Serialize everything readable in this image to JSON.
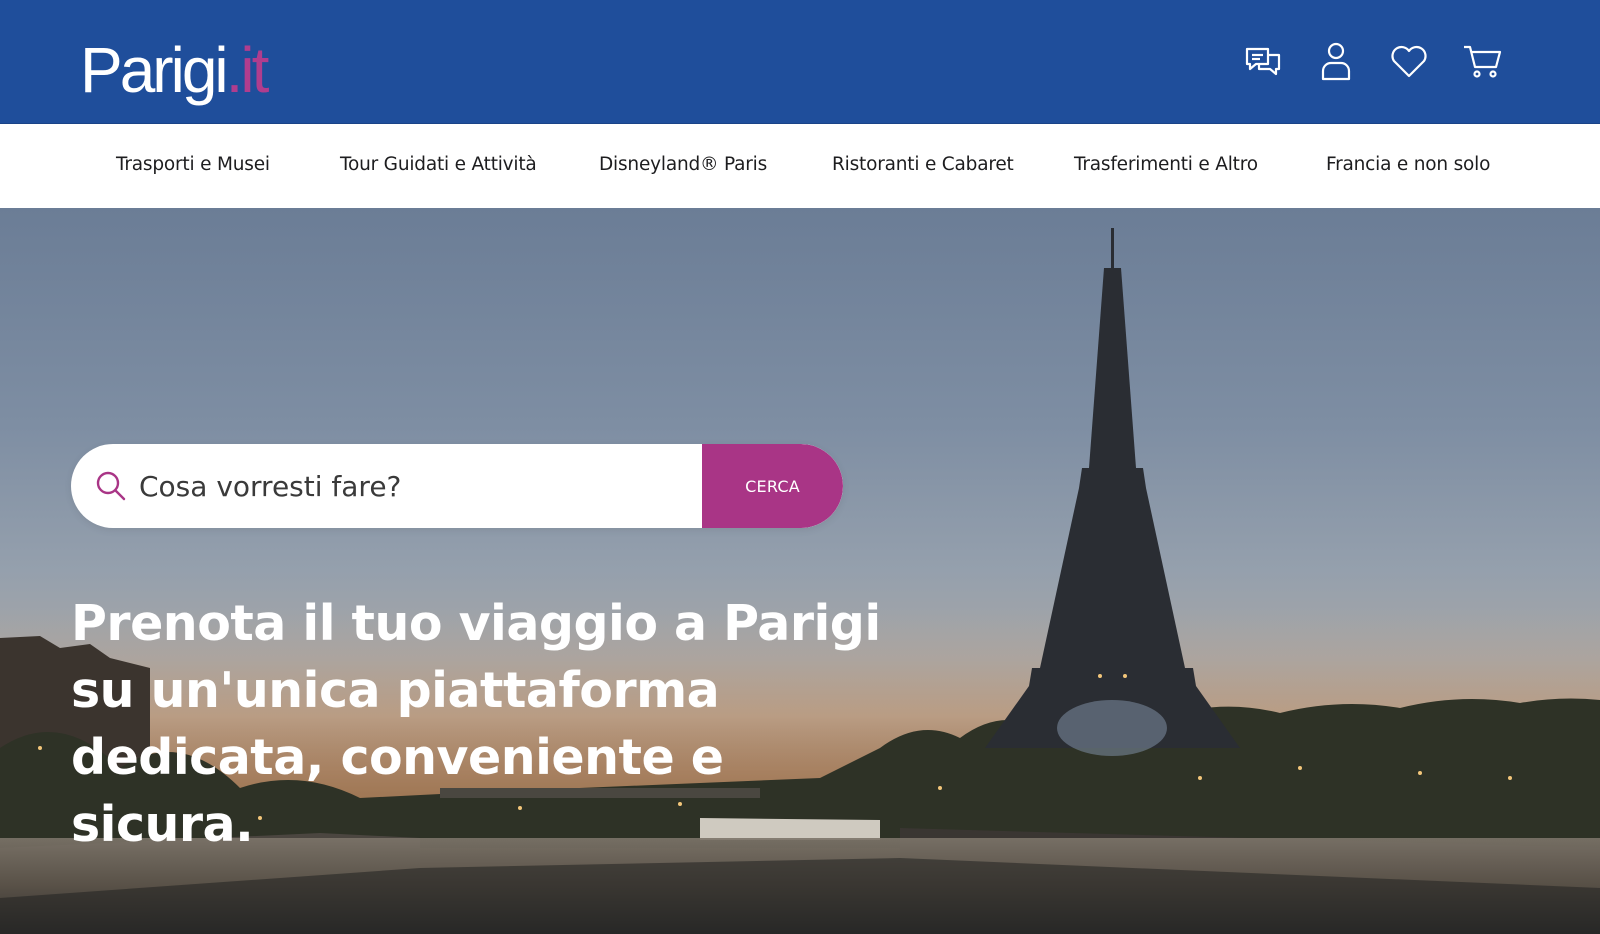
{
  "header": {
    "logo": {
      "main": "Parigi",
      "tld": ".it"
    },
    "icons": [
      {
        "name": "chat-icon"
      },
      {
        "name": "user-icon"
      },
      {
        "name": "heart-icon"
      },
      {
        "name": "cart-icon"
      }
    ],
    "colors": {
      "background": "#1f4e9b",
      "accent": "#a93586"
    }
  },
  "nav": {
    "items": [
      {
        "label": "Trasporti e Musei"
      },
      {
        "label": "Tour Guidati e Attività"
      },
      {
        "label": "Disneyland® Paris"
      },
      {
        "label": "Ristoranti e Cabaret"
      },
      {
        "label": "Trasferimenti e Altro"
      },
      {
        "label": "Francia e non solo"
      }
    ]
  },
  "hero": {
    "search": {
      "placeholder": "Cosa vorresti fare?",
      "value": "",
      "button_label": "CERCA"
    },
    "headline": "Prenota il tuo viaggio a Parigi su un'unica piattaforma dedicata, conveniente e sicura.",
    "background_image": "eiffel-tower-seine-dusk"
  }
}
